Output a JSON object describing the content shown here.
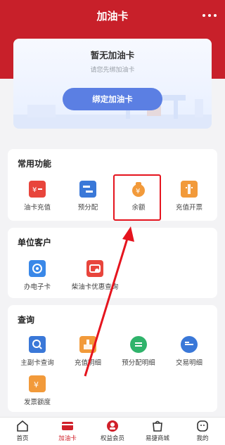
{
  "header": {
    "title": "加油卡"
  },
  "card": {
    "title": "暂无加油卡",
    "subtitle": "请您先绑加油卡",
    "bind_button": "绑定加油卡"
  },
  "common": {
    "title": "常用功能",
    "items": [
      {
        "label": "油卡充值",
        "icon": "card-recharge-icon",
        "color": "#e8453c"
      },
      {
        "label": "预分配",
        "icon": "allocate-icon",
        "color": "#3a78d8"
      },
      {
        "label": "余额",
        "icon": "money-bag-icon",
        "color": "#f29a3a"
      },
      {
        "label": "充值开票",
        "icon": "invoice-icon",
        "color": "#f29a3a"
      }
    ]
  },
  "company": {
    "title": "单位客户",
    "items": [
      {
        "label": "办电子卡",
        "icon": "e-card-icon",
        "color": "#3a88e8"
      },
      {
        "label": "柴油卡优惠查询",
        "icon": "diesel-discount-icon",
        "color": "#e8453c"
      }
    ]
  },
  "query": {
    "title": "查询",
    "items": [
      {
        "label": "主副卡查询",
        "icon": "search-card-icon",
        "color": "#3a78d8"
      },
      {
        "label": "充值明细",
        "icon": "recharge-detail-icon",
        "color": "#f29a3a"
      },
      {
        "label": "预分配明细",
        "icon": "allocate-detail-icon",
        "color": "#2fb36b"
      },
      {
        "label": "交易明细",
        "icon": "transaction-detail-icon",
        "color": "#3a78d8"
      },
      {
        "label": "发票额度",
        "icon": "invoice-quota-icon",
        "color": "#f29a3a"
      }
    ]
  },
  "tabbar": {
    "items": [
      {
        "label": "首页",
        "icon": "home-icon"
      },
      {
        "label": "加油卡",
        "icon": "fuel-card-icon"
      },
      {
        "label": "权益会员",
        "icon": "member-icon"
      },
      {
        "label": "易捷商城",
        "icon": "mall-icon"
      },
      {
        "label": "我的",
        "icon": "profile-icon"
      }
    ],
    "active_index": 1
  },
  "colors": {
    "brand_red": "#c8202a",
    "button_blue": "#5b7fe3",
    "highlight_red": "#e5141e"
  }
}
